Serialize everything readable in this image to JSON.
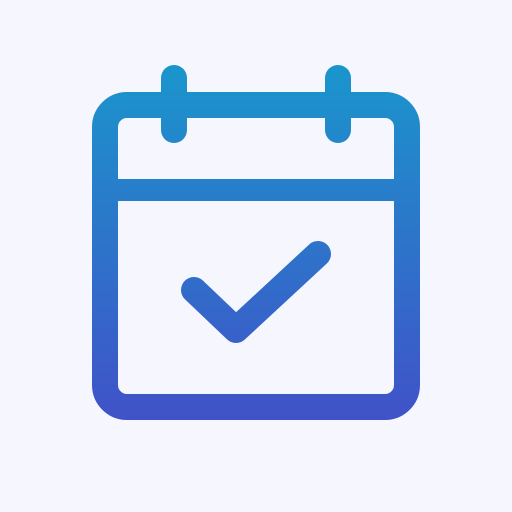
{
  "icon": {
    "name": "calendar-check-icon",
    "background_color": "#f5f6fe",
    "gradient_top_color": "#1a96cc",
    "gradient_bottom_color": "#4052c8"
  }
}
